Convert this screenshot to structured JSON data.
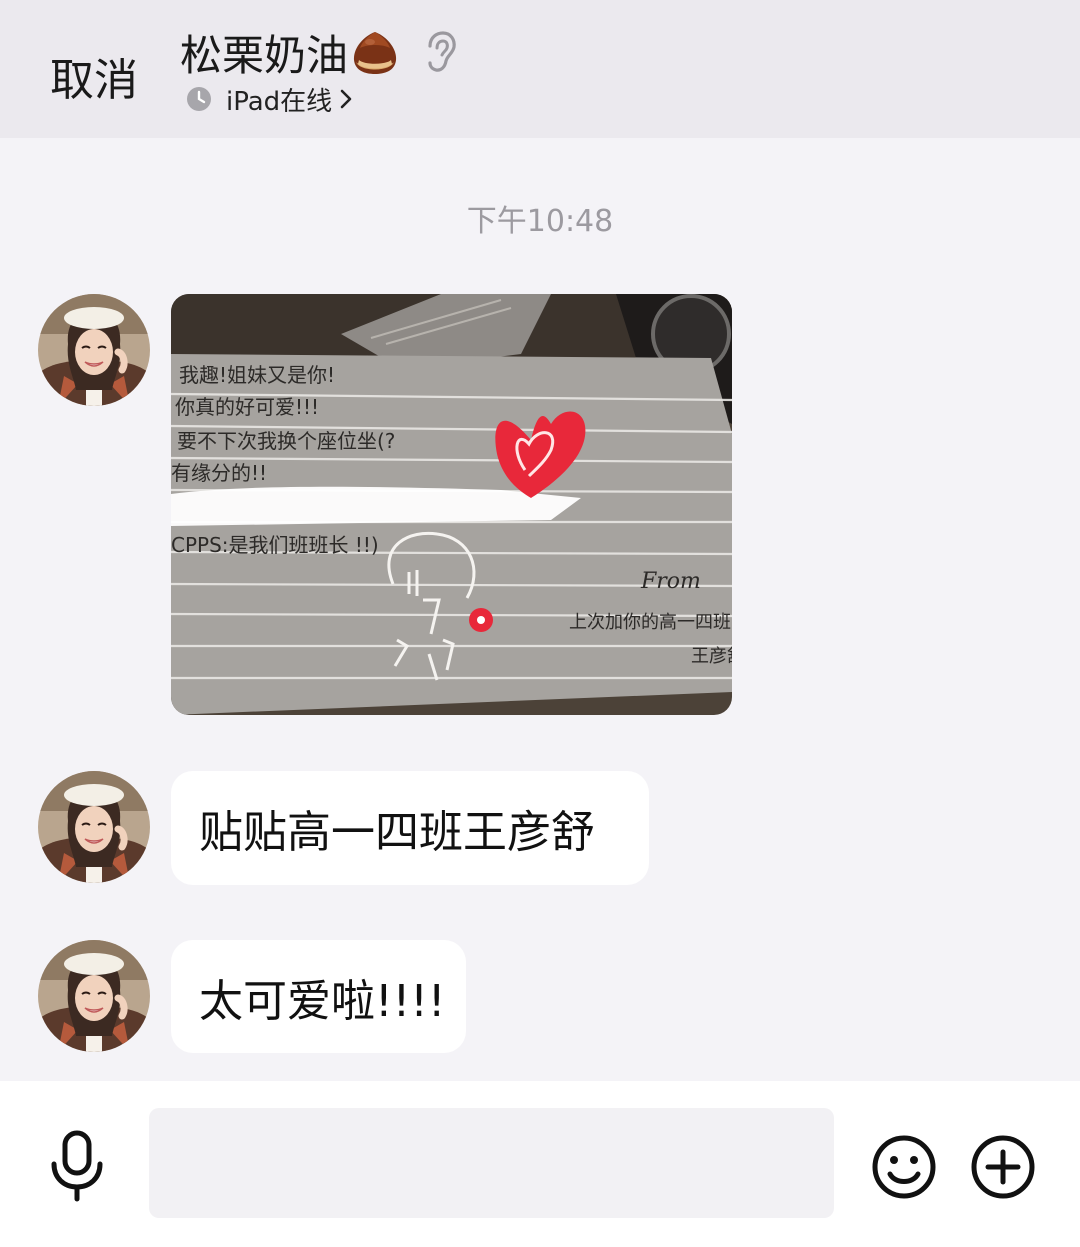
{
  "header": {
    "cancel_label": "取消",
    "contact_name": "松栗奶油",
    "status_text": "iPad在线"
  },
  "chat": {
    "timestamp": "下午10:48",
    "messages": [
      {
        "type": "image",
        "icon": "photo-card"
      },
      {
        "type": "text",
        "text": "贴贴高一四班王彦舒"
      },
      {
        "type": "text",
        "text": "太可爱啦!!!!"
      }
    ]
  },
  "photo_card": {
    "lines": [
      "我趣!姐妹又是你!",
      "你真的好可爱!!!",
      "要不下次我换个座位坐(?",
      "有缘分的!!",
      "CPPS:是我们班班长 !!)"
    ],
    "from_label": "From",
    "from_line": "上次加你的高一四班",
    "signature": "王彦舒"
  },
  "composer": {
    "input_value": "",
    "input_placeholder": ""
  },
  "icons": {
    "cancel": "text-button",
    "chestnut": "chestnut-emoji-icon",
    "ear": "ear-icon",
    "clock": "clock-icon",
    "chevron": "chevron-right-icon",
    "mic": "microphone-icon",
    "emoji": "smiley-icon",
    "plus": "plus-circle-icon"
  },
  "colors": {
    "topbar_bg": "#ebe9ee",
    "chat_bg": "#f4f3f7",
    "bubble_bg": "#ffffff",
    "timestamp": "#9c9aa0",
    "heart_red": "#e8283a"
  }
}
